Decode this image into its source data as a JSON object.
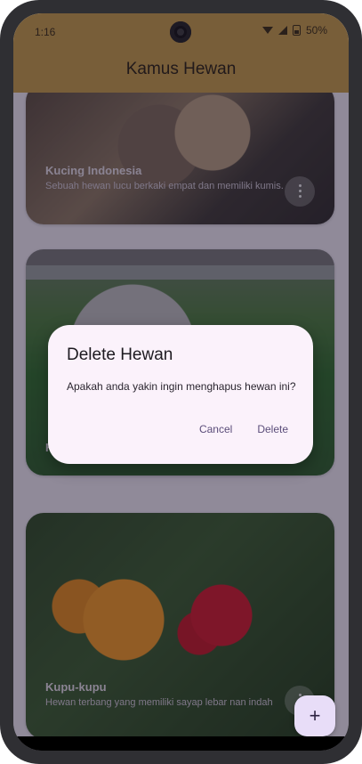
{
  "status": {
    "time": "1:16",
    "battery": "50%"
  },
  "appbar": {
    "title": "Kamus Hewan"
  },
  "cards": [
    {
      "title": "Kucing Indonesia",
      "desc": "Sebuah hewan lucu berkaki empat dan memiliki kumis."
    },
    {
      "title": "K",
      "desc": ""
    },
    {
      "title": "Kupu-kupu",
      "desc": "Hewan terbang yang memiliki sayap lebar nan indah"
    }
  ],
  "dialog": {
    "title": "Delete Hewan",
    "message": "Apakah anda yakin ingin menghapus hewan ini?",
    "cancel": "Cancel",
    "confirm": "Delete"
  },
  "fab": {
    "icon": "plus-icon",
    "label": "+"
  },
  "icons": {
    "wifi": "wifi-icon",
    "signal": "signal-icon",
    "battery": "battery-icon",
    "more": "more-vert-icon"
  },
  "colors": {
    "appbar": "#c79d47",
    "dialog": "#fbf2fb",
    "action": "#5b4d7a",
    "fab": "#e8ddf8"
  }
}
